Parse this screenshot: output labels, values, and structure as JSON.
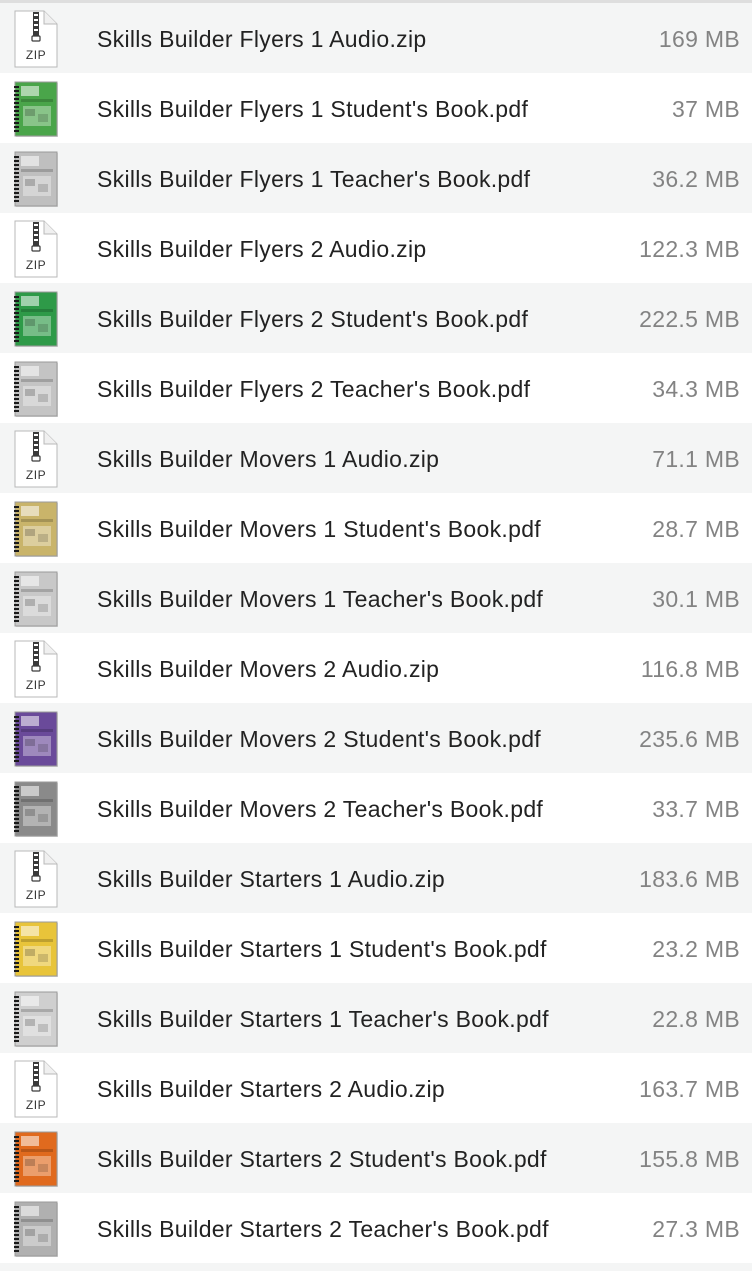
{
  "files": [
    {
      "name": "Skills Builder Flyers 1 Audio.zip",
      "size": "169 MB",
      "icon": "zip-file-icon",
      "zip_label": "ZIP",
      "color": ""
    },
    {
      "name": "Skills Builder Flyers 1 Student's Book.pdf",
      "size": "37 MB",
      "icon": "pdf-thumbnail-icon",
      "color": "#4aa54a"
    },
    {
      "name": "Skills Builder Flyers 1 Teacher's Book.pdf",
      "size": "36.2 MB",
      "icon": "pdf-thumbnail-icon",
      "color": "#bfbfbf"
    },
    {
      "name": "Skills Builder Flyers 2 Audio.zip",
      "size": "122.3 MB",
      "icon": "zip-file-icon",
      "zip_label": "ZIP",
      "color": ""
    },
    {
      "name": "Skills Builder Flyers 2 Student's Book.pdf",
      "size": "222.5 MB",
      "icon": "pdf-thumbnail-icon",
      "color": "#2e9a48"
    },
    {
      "name": "Skills Builder Flyers 2 Teacher's Book.pdf",
      "size": "34.3 MB",
      "icon": "pdf-thumbnail-icon",
      "color": "#c4c4c4"
    },
    {
      "name": "Skills Builder Movers 1 Audio.zip",
      "size": "71.1 MB",
      "icon": "zip-file-icon",
      "zip_label": "ZIP",
      "color": ""
    },
    {
      "name": "Skills Builder Movers 1 Student's Book.pdf",
      "size": "28.7 MB",
      "icon": "pdf-thumbnail-icon",
      "color": "#c9b46a"
    },
    {
      "name": "Skills Builder Movers 1 Teacher's Book.pdf",
      "size": "30.1 MB",
      "icon": "pdf-thumbnail-icon",
      "color": "#c8c8c8"
    },
    {
      "name": "Skills Builder Movers 2 Audio.zip",
      "size": "116.8 MB",
      "icon": "zip-file-icon",
      "zip_label": "ZIP",
      "color": ""
    },
    {
      "name": "Skills Builder Movers 2 Student's Book.pdf",
      "size": "235.6 MB",
      "icon": "pdf-thumbnail-icon",
      "color": "#6a4a9a"
    },
    {
      "name": "Skills Builder Movers 2 Teacher's Book.pdf",
      "size": "33.7 MB",
      "icon": "pdf-thumbnail-icon",
      "color": "#8a8a8a"
    },
    {
      "name": "Skills Builder Starters 1 Audio.zip",
      "size": "183.6 MB",
      "icon": "zip-file-icon",
      "zip_label": "ZIP",
      "color": ""
    },
    {
      "name": "Skills Builder Starters 1 Student's Book.pdf",
      "size": "23.2 MB",
      "icon": "pdf-thumbnail-icon",
      "color": "#e8c43a"
    },
    {
      "name": "Skills Builder Starters 1 Teacher's Book.pdf",
      "size": "22.8 MB",
      "icon": "pdf-thumbnail-icon",
      "color": "#cfcfcf"
    },
    {
      "name": "Skills Builder Starters 2 Audio.zip",
      "size": "163.7 MB",
      "icon": "zip-file-icon",
      "zip_label": "ZIP",
      "color": ""
    },
    {
      "name": "Skills Builder Starters 2 Student's Book.pdf",
      "size": "155.8 MB",
      "icon": "pdf-thumbnail-icon",
      "color": "#e06a1e"
    },
    {
      "name": "Skills Builder Starters 2 Teacher's Book.pdf",
      "size": "27.3 MB",
      "icon": "pdf-thumbnail-icon",
      "color": "#b0b0b0"
    }
  ]
}
